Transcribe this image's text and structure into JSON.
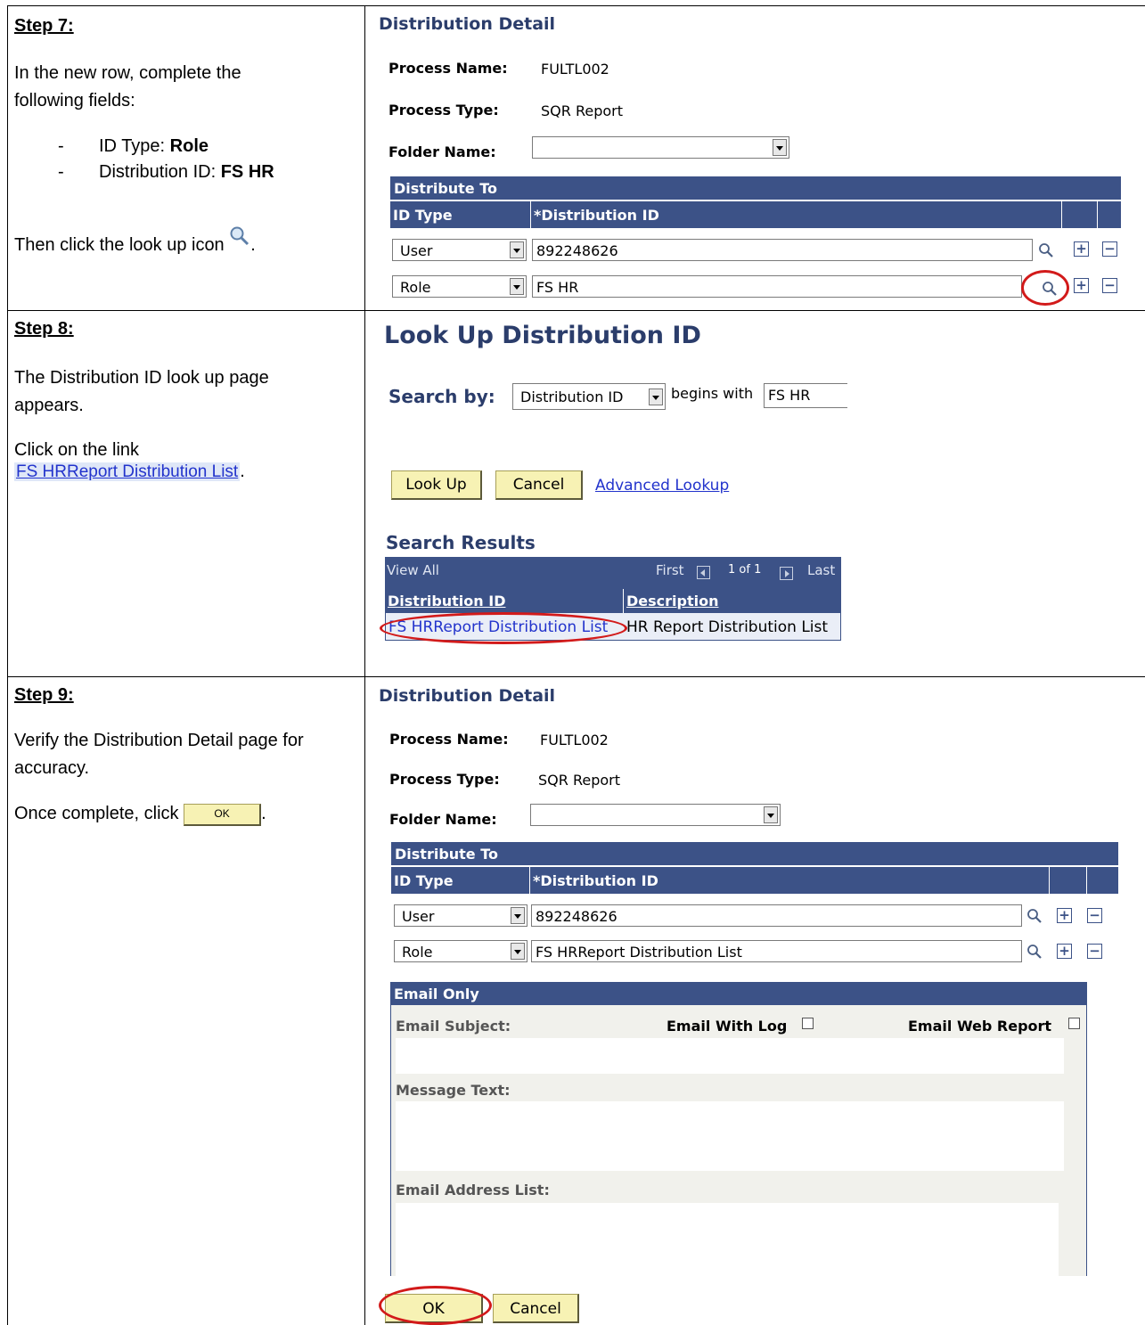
{
  "step7": {
    "heading": "Step 7:",
    "intro": "In the new row, complete the following fields:",
    "bullet1_label": "ID Type: ",
    "bullet1_value": "Role",
    "bullet2_label": "Distribution ID: ",
    "bullet2_value": "FS HR",
    "then_text": "Then click the look up icon",
    "period": "."
  },
  "detail1": {
    "title": "Distribution Detail",
    "process_name_label": "Process Name:",
    "process_name": "FULTL002",
    "process_type_label": "Process Type:",
    "process_type": "SQR Report",
    "folder_label": "Folder Name:",
    "folder_value": "",
    "distribute_to": "Distribute To",
    "col_id_type": "ID Type",
    "col_dist_id": "*Distribution ID",
    "rows": [
      {
        "id_type": "User",
        "dist_id": "892248626"
      },
      {
        "id_type": "Role",
        "dist_id": "FS HR"
      }
    ]
  },
  "step8": {
    "heading": "Step 8:",
    "intro": "The Distribution ID look up page appears.",
    "click_text": "Click on the link",
    "link_text": "FS HRReport Distribution List",
    "period": "."
  },
  "lookup": {
    "title": "Look Up Distribution ID",
    "search_by_label": "Search by:",
    "search_by_value": "Distribution ID",
    "begins_with": "begins with",
    "search_value": "FS HR",
    "lookup_btn": "Look Up",
    "cancel_btn": "Cancel",
    "advanced_link": "Advanced Lookup",
    "results_title": "Search Results",
    "view_all": "View All",
    "first": "First",
    "page_count": "1 of 1",
    "last": "Last",
    "col_dist_id": "Distribution ID",
    "col_desc": "Description",
    "result_id": "FS HRReport Distribution List",
    "result_desc": "HR Report Distribution List"
  },
  "step9": {
    "heading": "Step 9:",
    "intro": "Verify the Distribution Detail page for accuracy.",
    "once_text": "Once complete, click",
    "ok_img_label": "OK",
    "period": "."
  },
  "detail2": {
    "title": "Distribution Detail",
    "process_name_label": "Process Name:",
    "process_name": "FULTL002",
    "process_type_label": "Process Type:",
    "process_type": "SQR Report",
    "folder_label": "Folder Name:",
    "folder_value": "",
    "distribute_to": "Distribute To",
    "col_id_type": "ID Type",
    "col_dist_id": "*Distribution ID",
    "rows": [
      {
        "id_type": "User",
        "dist_id": "892248626"
      },
      {
        "id_type": "Role",
        "dist_id": "FS HRReport Distribution List"
      }
    ],
    "email_only": "Email Only",
    "email_subject": "Email Subject:",
    "email_with_log": "Email With Log",
    "email_web_report": "Email Web Report",
    "message_text": "Message Text:",
    "email_address_list": "Email Address List:",
    "ok_btn": "OK",
    "cancel_btn": "Cancel"
  }
}
